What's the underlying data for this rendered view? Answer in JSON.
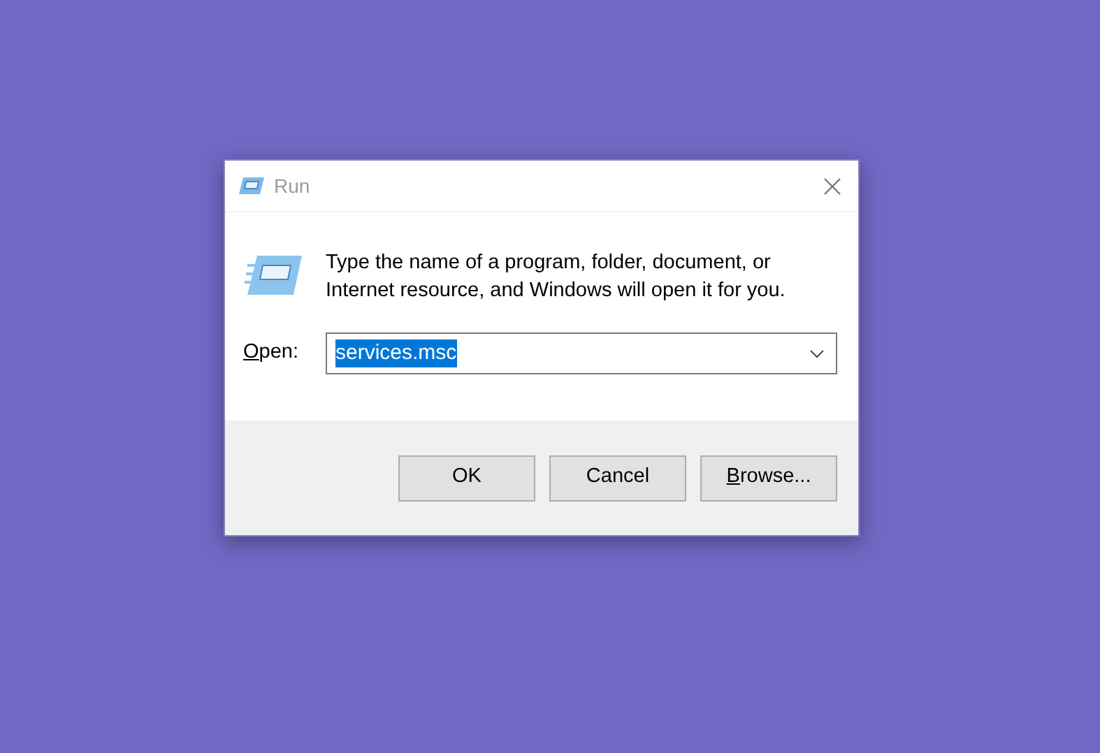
{
  "window": {
    "title": "Run"
  },
  "message": "Type the name of a program, folder, document, or Internet resource, and Windows will open it for you.",
  "open_field": {
    "label": {
      "access_key": "O",
      "rest": "pen:"
    },
    "value": "services.msc",
    "selected": true
  },
  "buttons": [
    {
      "rest": "OK"
    },
    {
      "rest": "Cancel"
    },
    {
      "access_key": "B",
      "rest": "rowse..."
    }
  ]
}
